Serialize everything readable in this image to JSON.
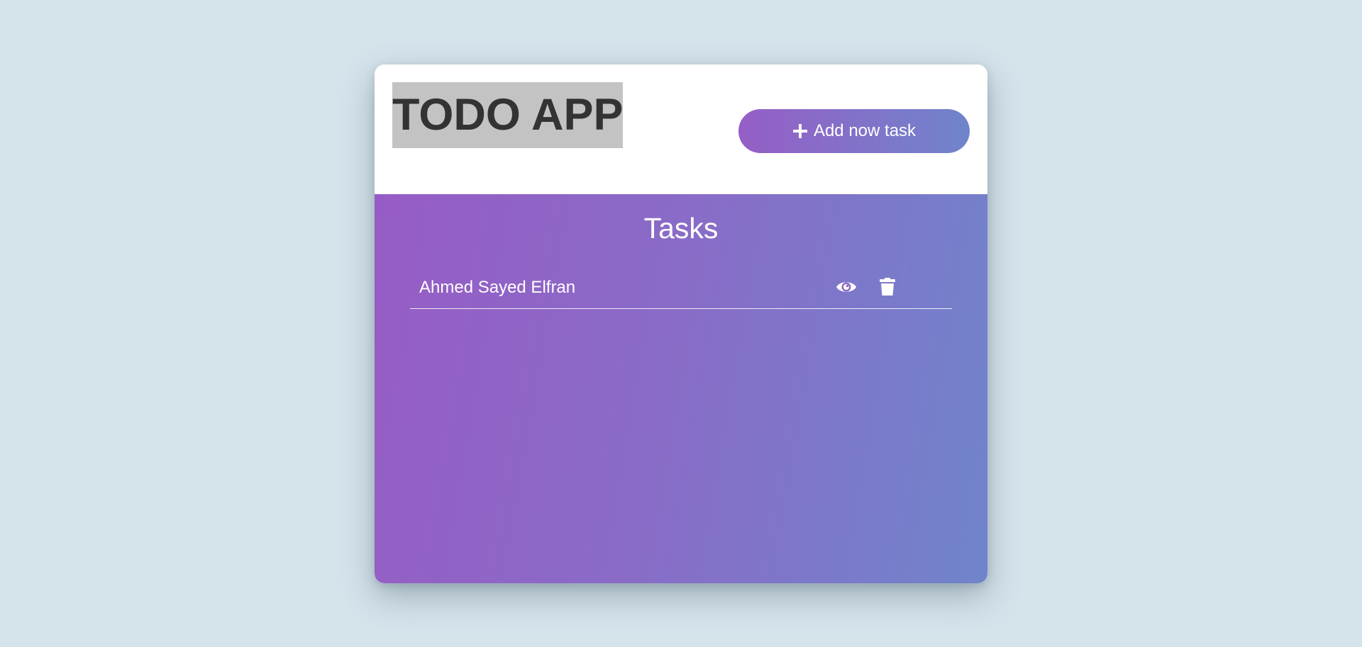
{
  "header": {
    "title": "TODO APP",
    "add_button_label": "Add now task",
    "add_button_icon": "plus-icon"
  },
  "tasks_panel": {
    "heading": "Tasks",
    "tasks": [
      {
        "name": "Ahmed Sayed Elfran",
        "actions": [
          {
            "icon": "eye-icon"
          },
          {
            "icon": "trash-icon"
          }
        ]
      }
    ]
  },
  "colors": {
    "background": "#d5e3eb",
    "card": "#ffffff",
    "title_highlight": "#c3c3c3",
    "title_text": "#333333",
    "gradient_start": "#965cc5",
    "gradient_end": "#7084cb",
    "panel_text": "#ffffff"
  }
}
